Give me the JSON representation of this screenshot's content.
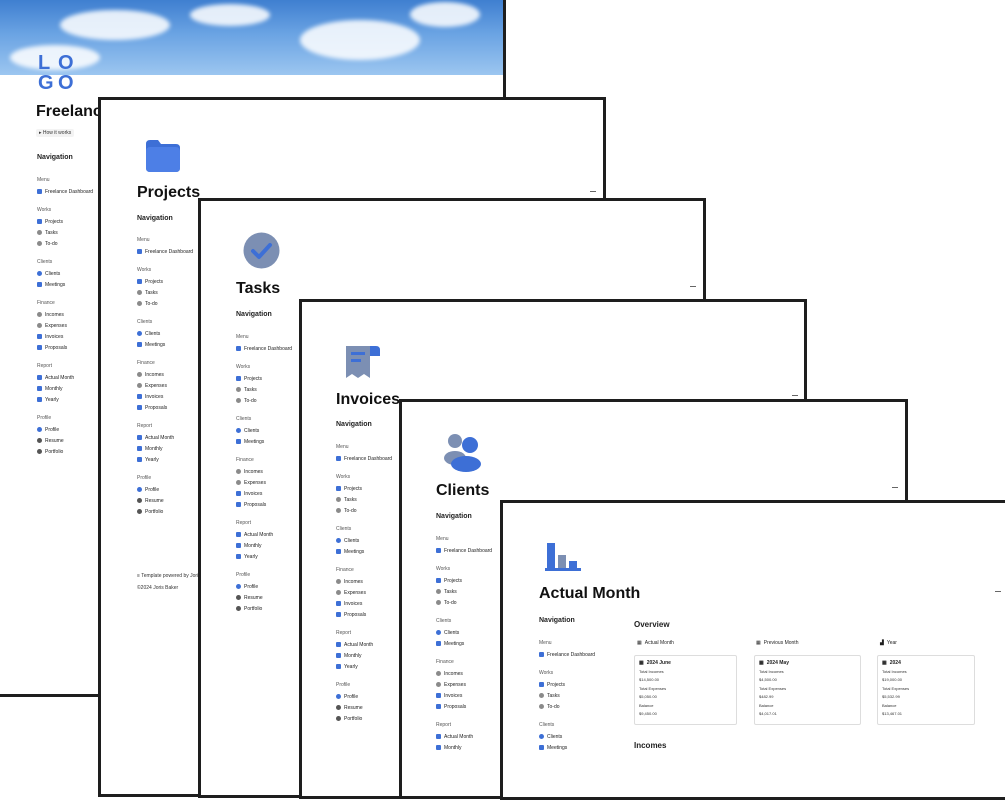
{
  "pages": [
    {
      "title": "Freelance Dashboard",
      "logo_text": [
        "L",
        "O",
        "G",
        "O"
      ],
      "how_it_works": "How it works",
      "footer_line1": "Template powered by Joris Baker",
      "footer_line2": "©2024 Joris Baker"
    },
    {
      "title": "Projects",
      "icon": "folder-icon"
    },
    {
      "title": "Tasks",
      "icon": "check-circle-icon"
    },
    {
      "title": "Invoices",
      "icon": "receipt-icon"
    },
    {
      "title": "Clients",
      "icon": "users-icon"
    },
    {
      "title": "Actual Month",
      "icon": "bar-chart-icon"
    }
  ],
  "navigation": {
    "heading": "Navigation",
    "menu_label": "Menu",
    "menu_item": "Freelance Dashboard",
    "works_label": "Works",
    "works": [
      "Projects",
      "Tasks",
      "To-do"
    ],
    "clients_label": "Clients",
    "clients": [
      "Clients",
      "Meetings"
    ],
    "finance_label": "Finance",
    "finance": [
      "Incomes",
      "Expenses",
      "Invoices",
      "Proposals"
    ],
    "report_label": "Report",
    "report": [
      "Actual Month",
      "Monthly",
      "Yearly"
    ],
    "profile_label": "Profile",
    "profile": [
      "Profile",
      "Resume",
      "Portfolio"
    ]
  },
  "overview": {
    "title": "Overview",
    "columns": [
      {
        "head": "Actual Month",
        "card_title": "2024 June",
        "incomes_label": "Total Incomes",
        "incomes": "$14,500.00",
        "expenses_label": "Total Expenses",
        "expenses": "$5,050.00",
        "balance_label": "Balance",
        "balance": "$9,450.00"
      },
      {
        "head": "Previous Month",
        "card_title": "2024 May",
        "incomes_label": "Total Incomes",
        "incomes": "$4,500.00",
        "expenses_label": "Total Expenses",
        "expenses": "$482.99",
        "balance_label": "Balance",
        "balance": "$4,017.01"
      },
      {
        "head": "Year",
        "card_title": "2024",
        "incomes_label": "Total Incomes",
        "incomes": "$19,000.00",
        "expenses_label": "Total Expenses",
        "expenses": "$5,532.99",
        "balance_label": "Balance",
        "balance": "$13,467.01"
      }
    ],
    "incomes_heading": "Incomes"
  },
  "colors": {
    "accent": "#3d6fd6",
    "border": "#1e1e1e"
  }
}
